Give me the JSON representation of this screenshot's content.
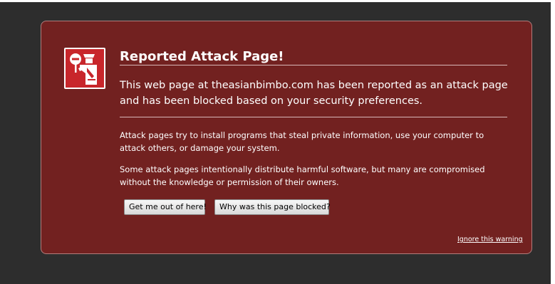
{
  "colors": {
    "background": "#2d2d2d",
    "panel": "#722120",
    "panel_border": "#b07e7d",
    "icon_background": "#c8262b",
    "text": "#ffffff"
  },
  "warning": {
    "icon": "police-officer-stop-icon",
    "title": "Reported Attack Page!",
    "short_description": "This web page at theasianbimbo.com has been reported as an attack page and has been blocked based on your security preferences.",
    "long_description_1": "Attack pages try to install programs that steal private information, use your computer to attack others, or damage your system.",
    "long_description_2": "Some attack pages intentionally distribute harmful software, but many are compromised without the knowledge or permission of their owners."
  },
  "buttons": {
    "get_me_out_label": "Get me out of here!",
    "why_blocked_label": "Why was this page blocked?"
  },
  "links": {
    "ignore_warning_label": "Ignore this warning"
  }
}
